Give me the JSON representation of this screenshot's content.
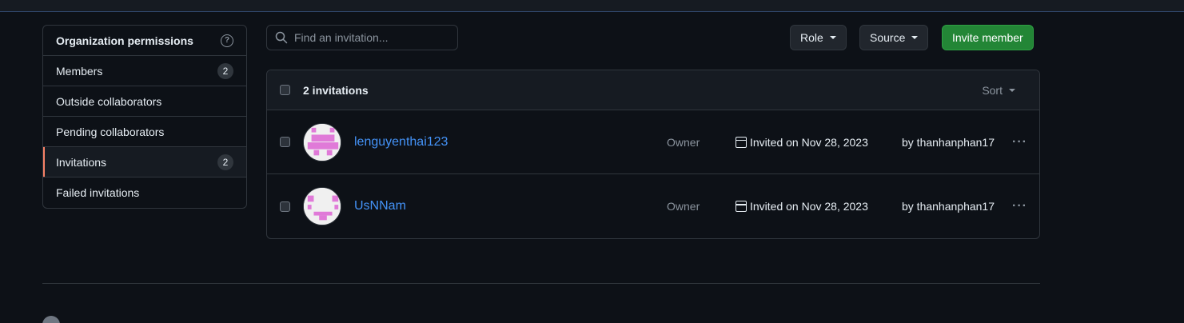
{
  "sidebar": {
    "title": "Organization permissions",
    "items": [
      {
        "label": "Members",
        "count": "2"
      },
      {
        "label": "Outside collaborators"
      },
      {
        "label": "Pending collaborators"
      },
      {
        "label": "Invitations",
        "count": "2",
        "active": true
      },
      {
        "label": "Failed invitations"
      }
    ]
  },
  "search": {
    "placeholder": "Find an invitation..."
  },
  "filters": {
    "role_label": "Role",
    "source_label": "Source"
  },
  "invite_button": {
    "label": "Invite member"
  },
  "table": {
    "title": "2 invitations",
    "sort_label": "Sort",
    "rows": [
      {
        "username": "lenguyenthai123",
        "role": "Owner",
        "invited": "Invited on Nov 28, 2023",
        "by": "by thanhanphan17"
      },
      {
        "username": "UsNNam",
        "role": "Owner",
        "invited": "Invited on Nov 28, 2023",
        "by": "by thanhanphan17"
      }
    ]
  },
  "colors": {
    "accent_primary": "#238636",
    "link": "#4493f8",
    "active_marker": "#f78166",
    "avatar_pink": "#e07ad8"
  },
  "icons": [
    "question-icon",
    "search-icon",
    "caret-down-icon",
    "calendar-icon",
    "kebab-icon",
    "github-logo-icon"
  ]
}
